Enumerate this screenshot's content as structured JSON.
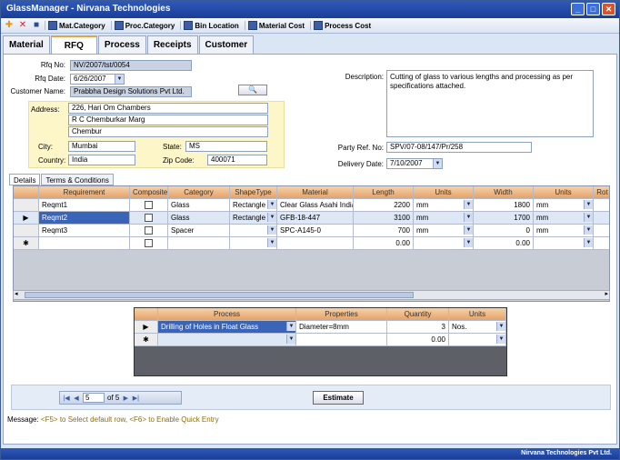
{
  "window": {
    "title": "GlassManager - Nirvana Technologies"
  },
  "toolbar": {
    "icons": [
      "add-icon",
      "delete-icon",
      "save-icon"
    ],
    "items": [
      "Mat.Category",
      "Proc.Category",
      "Bin Location",
      "Material Cost",
      "Process Cost"
    ]
  },
  "main_tabs": [
    "Material",
    "RFQ",
    "Process",
    "Receipts",
    "Customer"
  ],
  "form": {
    "rfq_no_label": "Rfq No:",
    "rfq_no": "NV/2007/tst/0054",
    "rfq_date_label": "Rfq Date:",
    "rfq_date": "6/26/2007",
    "customer_label": "Customer Name:",
    "customer": "Prabbha Design Solutions Pvt Ltd.",
    "address_label": "Address:",
    "address_lines": [
      "226, Hari Om Chambers",
      "R C Chemburkar Marg",
      "Chembur"
    ],
    "city_label": "City:",
    "city": "Mumbai",
    "state_label": "State:",
    "state": "MS",
    "country_label": "Country:",
    "country": "India",
    "zip_label": "Zip Code:",
    "zip": "400071",
    "description_label": "Description:",
    "description": "Cutting of glass to various lengths and processing as per specifications attached.",
    "party_ref_label": "Party Ref. No:",
    "party_ref": "SPV/07-08/147/Pr/258",
    "delivery_label": "Delivery Date:",
    "delivery": "7/10/2007"
  },
  "sub_tabs": [
    "Details",
    "Terms & Conditions"
  ],
  "details_grid": {
    "columns": [
      "Requirement",
      "Composite?",
      "Category",
      "ShapeType",
      "Material",
      "Length",
      "Units",
      "Width",
      "Units",
      "Rot"
    ],
    "rows": [
      {
        "req": "Reqmt1",
        "category": "Glass",
        "shape": "Rectangle",
        "material": "Clear Glass Asahi India",
        "length": "2200",
        "lunit": "mm",
        "width": "1800",
        "wunit": "mm"
      },
      {
        "req": "Reqmt2",
        "category": "Glass",
        "shape": "Rectangle",
        "material": "GFB-18-447",
        "length": "3100",
        "lunit": "mm",
        "width": "1700",
        "wunit": "mm"
      },
      {
        "req": "Reqmt3",
        "category": "Spacer",
        "shape": "",
        "material": "SPC-A145-0",
        "length": "700",
        "lunit": "mm",
        "width": "0",
        "wunit": "mm"
      },
      {
        "req": "",
        "category": "",
        "shape": "",
        "material": "",
        "length": "0.00",
        "lunit": "",
        "width": "0.00",
        "wunit": ""
      }
    ]
  },
  "process_grid": {
    "columns": [
      "Process",
      "Properties",
      "Quantity",
      "Units"
    ],
    "rows": [
      {
        "process": "Drilling of Holes in Float Glass",
        "props": "Diameter=8mm",
        "qty": "3",
        "unit": "Nos."
      },
      {
        "process": "",
        "props": "",
        "qty": "0.00",
        "unit": ""
      }
    ]
  },
  "navigator": {
    "page": "5",
    "of": "of 5"
  },
  "estimate_label": "Estimate",
  "message": {
    "label": "Message:",
    "text": "<F5> to Select default row, <F6> to Enable Quick Entry"
  },
  "status": "Nirvana Technologies Pvt Ltd."
}
